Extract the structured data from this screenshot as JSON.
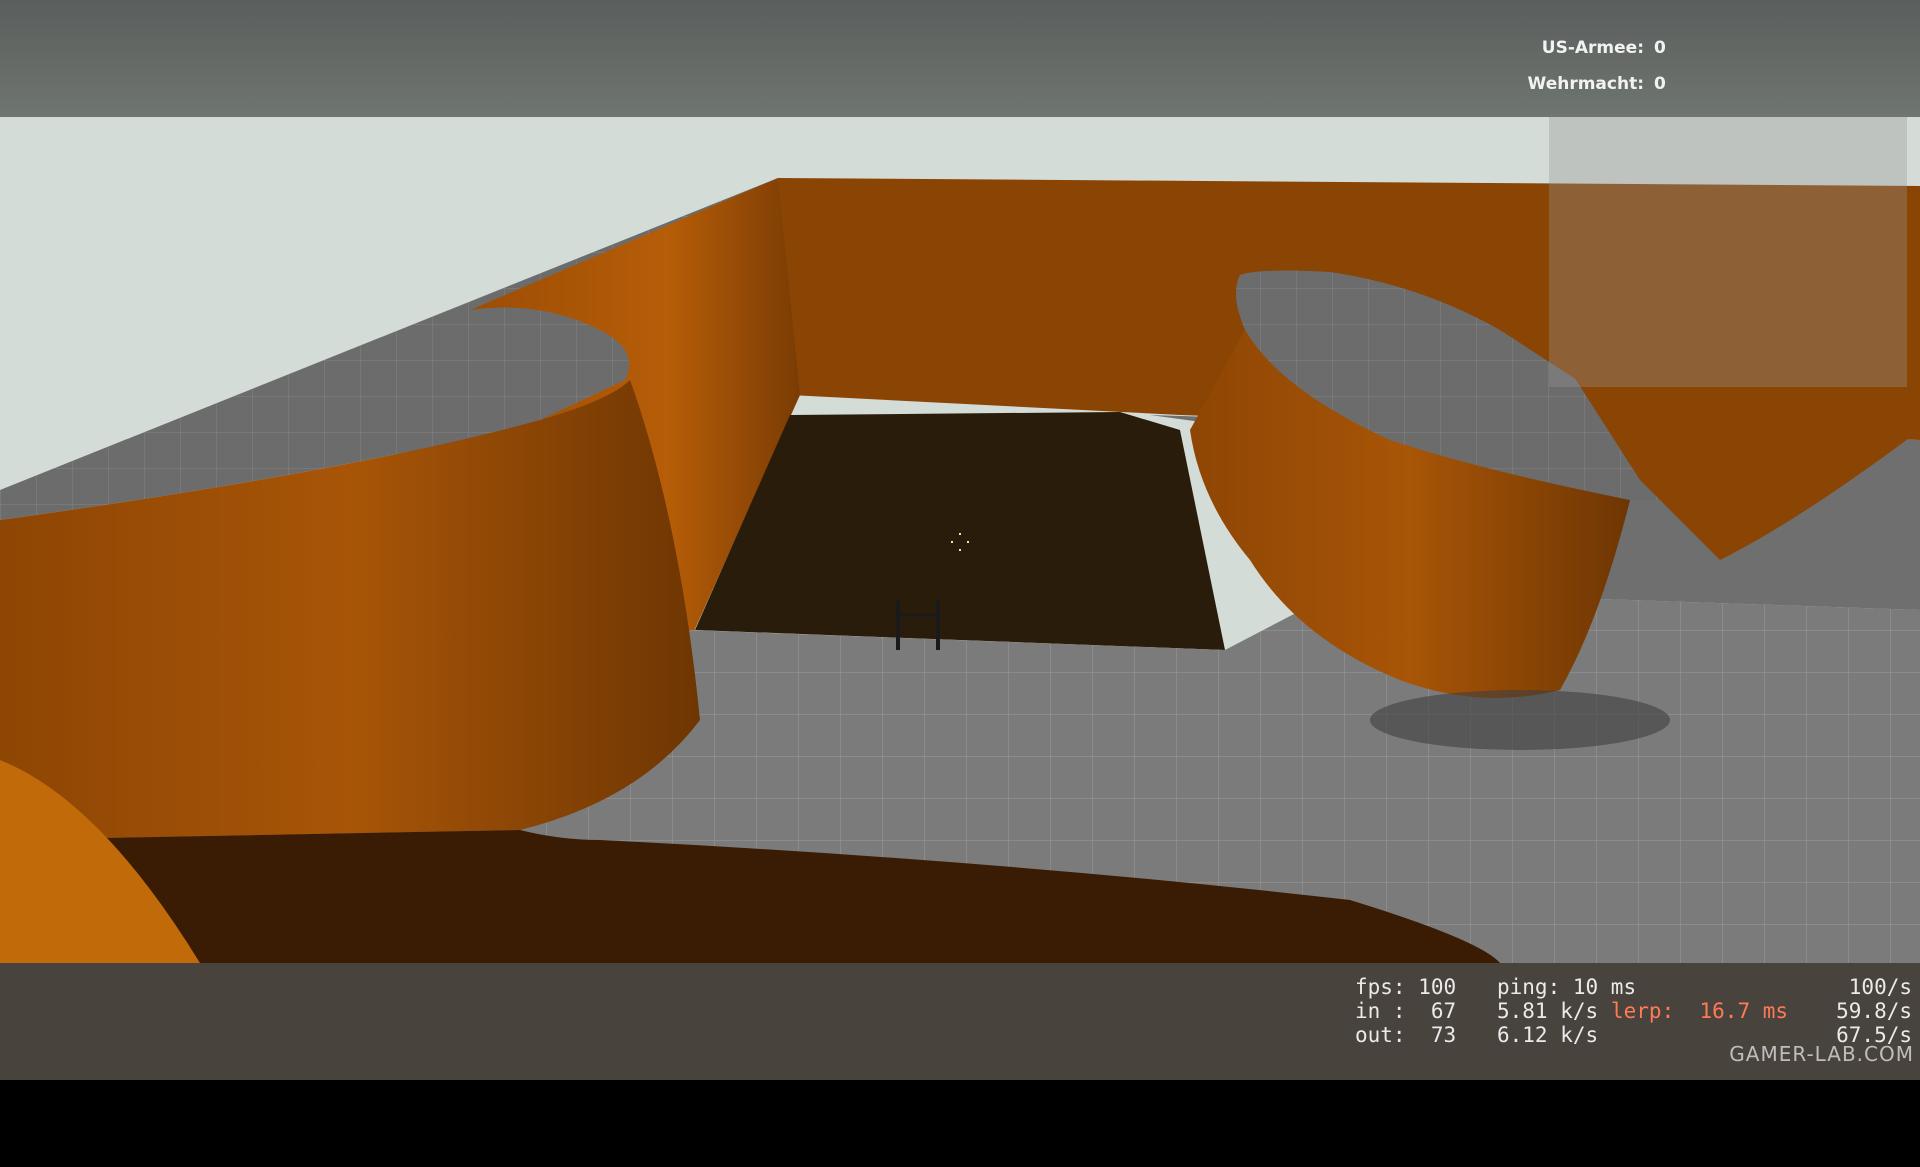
{
  "hud": {
    "scoreboard": [
      {
        "team": "US-Armee:",
        "score": "0"
      },
      {
        "team": "Wehrmacht:",
        "score": "0"
      }
    ]
  },
  "net_graph": {
    "fps_label": "fps:",
    "fps": "100",
    "ping_label": "ping:",
    "ping": "10 ms",
    "in_label": "in :",
    "in": "67",
    "in_rate": "5.81 k/s",
    "lerp_label": "lerp:",
    "lerp": "16.7 ms",
    "out_label": "out:",
    "out": "73",
    "out_rate": "6.12 k/s",
    "rate1": "100/s",
    "rate2": "59.8/s",
    "rate3": "67.5/s"
  },
  "watermark": "GAMER-LAB.COM",
  "colors": {
    "wall": "#b35a06",
    "floor": "#7a7a7a",
    "sky": "#d6ddd9",
    "lerp": "#ff7a55"
  }
}
